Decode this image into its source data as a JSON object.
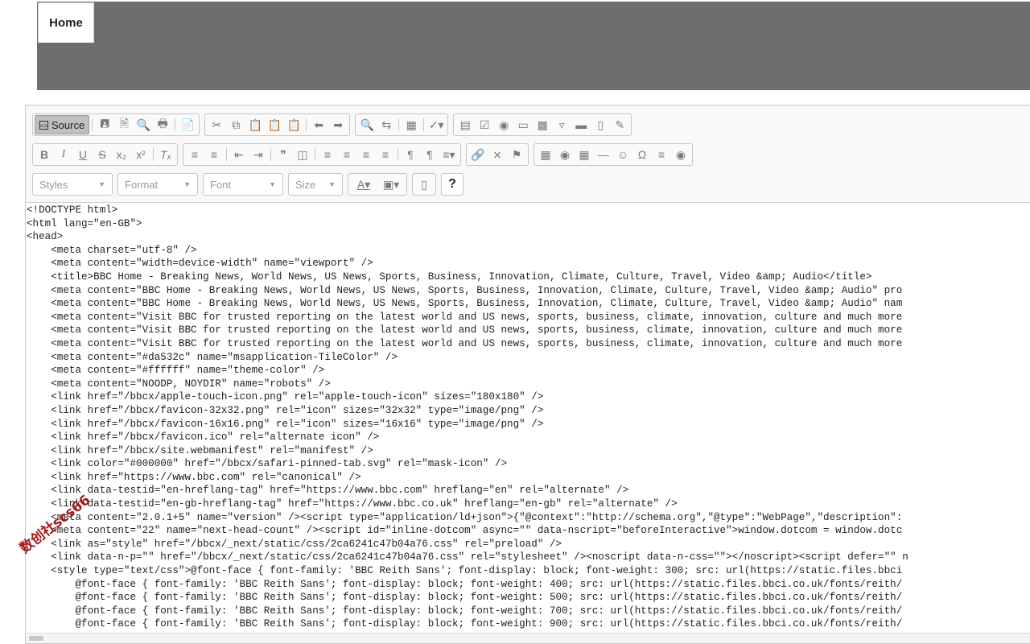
{
  "tabs": {
    "home_label": "Home"
  },
  "toolbar": {
    "source_label": "Source",
    "styles_label": "Styles",
    "format_label": "Format",
    "font_label": "Font",
    "size_label": "Size",
    "help_label": "?"
  },
  "code_lines": [
    "<!DOCTYPE html>",
    "<html lang=\"en-GB\">",
    "<head>",
    "    <meta charset=\"utf-8\" />",
    "    <meta content=\"width=device-width\" name=\"viewport\" />",
    "    <title>BBC Home - Breaking News, World News, US News, Sports, Business, Innovation, Climate, Culture, Travel, Video &amp; Audio</title>",
    "    <meta content=\"BBC Home - Breaking News, World News, US News, Sports, Business, Innovation, Climate, Culture, Travel, Video &amp; Audio\" pro",
    "    <meta content=\"BBC Home - Breaking News, World News, US News, Sports, Business, Innovation, Climate, Culture, Travel, Video &amp; Audio\" nam",
    "    <meta content=\"Visit BBC for trusted reporting on the latest world and US news, sports, business, climate, innovation, culture and much more",
    "    <meta content=\"Visit BBC for trusted reporting on the latest world and US news, sports, business, climate, innovation, culture and much more",
    "    <meta content=\"Visit BBC for trusted reporting on the latest world and US news, sports, business, climate, innovation, culture and much more",
    "    <meta content=\"#da532c\" name=\"msapplication-TileColor\" />",
    "    <meta content=\"#ffffff\" name=\"theme-color\" />",
    "    <meta content=\"NOODP, NOYDIR\" name=\"robots\" />",
    "    <link href=\"/bbcx/apple-touch-icon.png\" rel=\"apple-touch-icon\" sizes=\"180x180\" />",
    "    <link href=\"/bbcx/favicon-32x32.png\" rel=\"icon\" sizes=\"32x32\" type=\"image/png\" />",
    "    <link href=\"/bbcx/favicon-16x16.png\" rel=\"icon\" sizes=\"16x16\" type=\"image/png\" />",
    "    <link href=\"/bbcx/favicon.ico\" rel=\"alternate icon\" />",
    "    <link href=\"/bbcx/site.webmanifest\" rel=\"manifest\" />",
    "    <link color=\"#000000\" href=\"/bbcx/safari-pinned-tab.svg\" rel=\"mask-icon\" />",
    "    <link href=\"https://www.bbc.com\" rel=\"canonical\" />",
    "    <link data-testid=\"en-hreflang-tag\" href=\"https://www.bbc.com\" hreflang=\"en\" rel=\"alternate\" />",
    "    <link data-testid=\"en-gb-hreflang-tag\" href=\"https://www.bbc.co.uk\" hreflang=\"en-gb\" rel=\"alternate\" />",
    "    <meta content=\"2.0.1+5\" name=\"version\" /><script type=\"application/ld+json\">{\"@context\":\"http://schema.org\",\"@type\":\"WebPage\",\"description\":",
    "    <meta content=\"22\" name=\"next-head-count\" /><script id=\"inline-dotcom\" async=\"\" data-nscript=\"beforeInteractive\">window.dotcom = window.dotc",
    "    <link as=\"style\" href=\"/bbcx/_next/static/css/2ca6241c47b04a76.css\" rel=\"preload\" />",
    "    <link data-n-p=\"\" href=\"/bbcx/_next/static/css/2ca6241c47b04a76.css\" rel=\"stylesheet\" /><noscript data-n-css=\"\"></noscript><script defer=\"\" n",
    "    <style type=\"text/css\">@font-face { font-family: 'BBC Reith Sans'; font-display: block; font-weight: 300; src: url(https://static.files.bbci",
    "        @font-face { font-family: 'BBC Reith Sans'; font-display: block; font-weight: 400; src: url(https://static.files.bbci.co.uk/fonts/reith/",
    "        @font-face { font-family: 'BBC Reith Sans'; font-display: block; font-weight: 500; src: url(https://static.files.bbci.co.uk/fonts/reith/",
    "        @font-face { font-family: 'BBC Reith Sans'; font-display: block; font-weight: 700; src: url(https://static.files.bbci.co.uk/fonts/reith/",
    "        @font-face { font-family: 'BBC Reith Sans'; font-display: block; font-weight: 900; src: url(https://static.files.bbci.co.uk/fonts/reith/"
  ],
  "watermark": "数创社scs66"
}
